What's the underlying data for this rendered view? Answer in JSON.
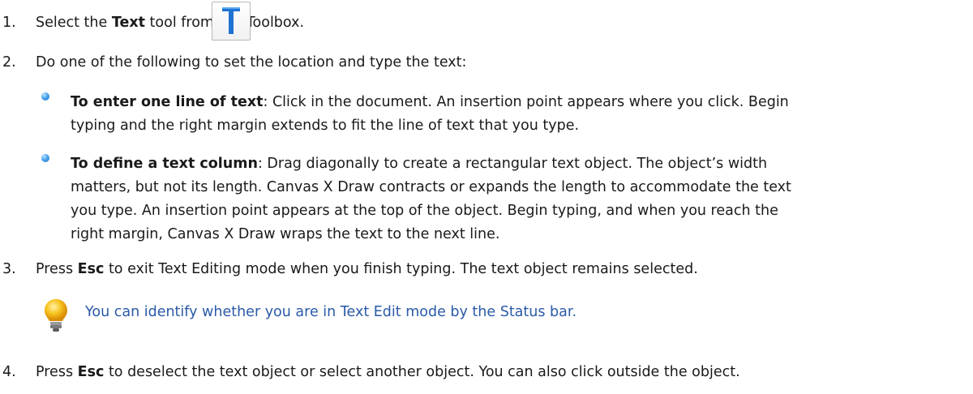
{
  "steps": [
    {
      "number": "1.",
      "pre": "Select the ",
      "bold": "Text",
      "post": " tool from the Toolbox."
    },
    {
      "number": "2.",
      "text": "Do one of the following to set the location and type the text:"
    },
    {
      "number": "3.",
      "pre": "Press ",
      "bold": "Esc",
      "post": " to exit Text Editing mode when you finish typing. The text object remains selected."
    },
    {
      "number": "4.",
      "pre": "Press ",
      "bold": "Esc",
      "post": " to deselect the text object or select another object. You can also click outside the object."
    }
  ],
  "toolbox_icon": {
    "letter": "T",
    "icon": "text-tool-icon",
    "color": "#1f73d1"
  },
  "bullets": [
    {
      "title": "To enter one line of text",
      "lines": [
        ": Click in the document. An insertion point appears where you click. Begin",
        "typing and the right margin extends to fit the line of text that you type."
      ]
    },
    {
      "title": "To define a text column",
      "lines": [
        ": Drag diagonally to create a rectangular text object. The object’s width",
        "matters, but not its length. Canvas X Draw contracts or expands the length to accommodate the text",
        "you type. An insertion point appears at the top of the object. Begin typing, and when you reach the",
        "right margin, Canvas X Draw wraps the text to the next line."
      ]
    }
  ],
  "tip": {
    "icon": "lightbulb-icon",
    "text": "You can identify whether you are in Text Edit mode by the Status bar."
  }
}
